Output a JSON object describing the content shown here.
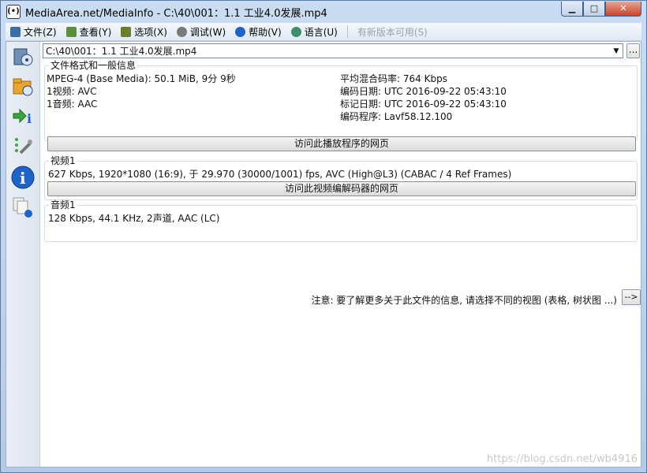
{
  "window": {
    "title": "MediaArea.net/MediaInfo - C:\\40\\001：1.1 工业4.0发展.mp4",
    "app_icon_glyph": "(•)",
    "minimize_glyph": "▁",
    "maximize_glyph": "□",
    "close_glyph": "✕"
  },
  "menu": {
    "items": [
      {
        "label": "文件(Z)",
        "icon": "file-menu-icon",
        "color": "#3a6ea5"
      },
      {
        "label": "查看(Y)",
        "icon": "view-menu-icon",
        "color": "#5a8f3c"
      },
      {
        "label": "选项(X)",
        "icon": "options-menu-icon",
        "color": "#6a7f2a"
      },
      {
        "label": "调试(W)",
        "icon": "debug-menu-icon",
        "color": "#7a7a7a"
      },
      {
        "label": "帮助(V)",
        "icon": "help-menu-icon",
        "color": "#1e64c8"
      },
      {
        "label": "语言(U)",
        "icon": "language-menu-icon",
        "color": "#3c8f6a"
      }
    ],
    "update_label": "有新版本可用(S)"
  },
  "file_select": {
    "value": "C:\\40\\001：1.1 工业4.0发展.mp4",
    "dropdown_glyph": "▼",
    "browse_label": "..."
  },
  "general": {
    "title": "文件格式和一般信息",
    "left": [
      "MPEG-4 (Base Media): 50.1 MiB, 9分 9秒",
      "1视频: AVC",
      "1音频: AAC"
    ],
    "right": [
      "平均混合码率: 764 Kbps",
      "编码日期: UTC 2016-09-22 05:43:10",
      "标记日期: UTC 2016-09-22 05:43:10",
      "编码程序: Lavf58.12.100"
    ],
    "button": "访问此播放程序的网页"
  },
  "video": {
    "title": "视频1",
    "info": "627 Kbps, 1920*1080 (16:9), 于 29.970 (30000/1001) fps, AVC (High@L3) (CABAC / 4 Ref Frames)",
    "button": "访问此视频编解码器的网页"
  },
  "audio": {
    "title": "音频1",
    "info": "128 Kbps, 44.1 KHz, 2声道, AAC (LC)"
  },
  "note": {
    "text": "注意: 要了解更多关于此文件的信息, 请选择不同的视图 (表格, 树状图 ...)",
    "button": "-->"
  },
  "watermark": "https://blog.csdn.net/wb4916"
}
